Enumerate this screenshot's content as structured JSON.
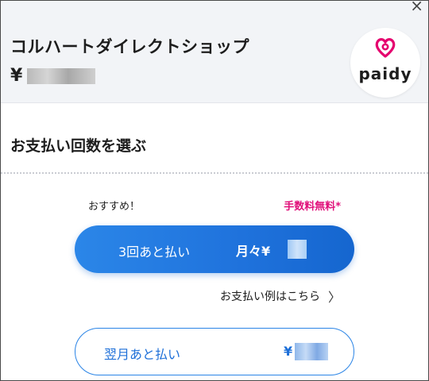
{
  "header": {
    "merchant_name": "コルハートダイレクトショップ",
    "currency_symbol": "¥",
    "close_glyph": "×",
    "logo_text": "paidy"
  },
  "section": {
    "title": "お支払い回数を選ぶ"
  },
  "options": {
    "recommend_label": "おすすめ！",
    "fee_label": "手数料無料*",
    "installment": {
      "label": "3回あと払い",
      "monthly_prefix": "月々¥"
    },
    "example_link": {
      "label": "お支払い例はこちら",
      "chevron": "〉"
    },
    "next_month": {
      "label": "翌月あと払い",
      "price_prefix": "¥"
    }
  },
  "colors": {
    "primary_blue": "#1f72dc",
    "fee_pink": "#e0107a",
    "logo_pink": "#e5006e",
    "header_bg": "#f2f4f7"
  }
}
